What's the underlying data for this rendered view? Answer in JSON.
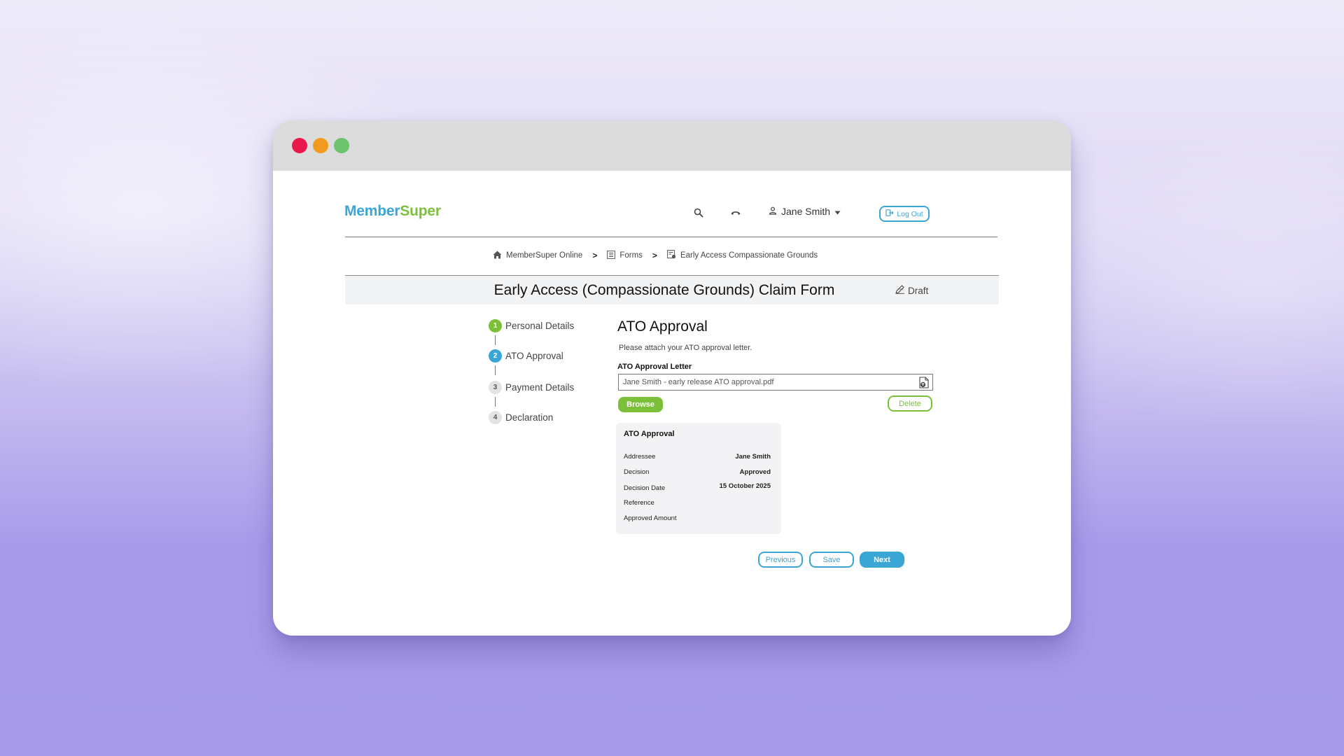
{
  "colors": {
    "brand_blue": "#3aa6d6",
    "brand_green": "#7cc03a"
  },
  "window": {
    "controls": [
      "close",
      "minimize",
      "maximize"
    ]
  },
  "header": {
    "logo_part1": "Member",
    "logo_part2": "Super",
    "search_icon": "search-icon",
    "phone_icon": "phone-icon",
    "user_name": "Jane Smith",
    "logout_label": "Log Out"
  },
  "breadcrumb": {
    "items": [
      {
        "label": "MemberSuper Online",
        "icon": "home-icon"
      },
      {
        "label": "Forms",
        "icon": "list-icon"
      },
      {
        "label": "Early Access Compassionate Grounds",
        "icon": "form-icon"
      }
    ],
    "separator": ">"
  },
  "page": {
    "title": "Early Access (Compassionate Grounds) Claim Form",
    "status": "Draft"
  },
  "steps": [
    {
      "num": "1",
      "label": "Personal Details",
      "state": "done"
    },
    {
      "num": "2",
      "label": "ATO Approval",
      "state": "active"
    },
    {
      "num": "3",
      "label": "Payment Details",
      "state": "todo"
    },
    {
      "num": "4",
      "label": "Declaration",
      "state": "todo"
    }
  ],
  "section": {
    "title": "ATO Approval",
    "description": "Please attach your ATO approval letter.",
    "field_label": "ATO Approval Letter",
    "file_name": "Jane Smith - early release ATO approval.pdf",
    "browse_label": "Browse",
    "delete_label": "Delete"
  },
  "card": {
    "title": "ATO Approval",
    "rows": [
      {
        "label": "Addressee",
        "value": "Jane Smith"
      },
      {
        "label": "Decision",
        "value": "Approved"
      },
      {
        "label": "Decision Date",
        "value": "15 October 2025"
      },
      {
        "label": "Reference",
        "value": ""
      },
      {
        "label": "Approved Amount",
        "value": ""
      }
    ]
  },
  "actions": {
    "previous": "Previous",
    "save": "Save",
    "next": "Next"
  }
}
